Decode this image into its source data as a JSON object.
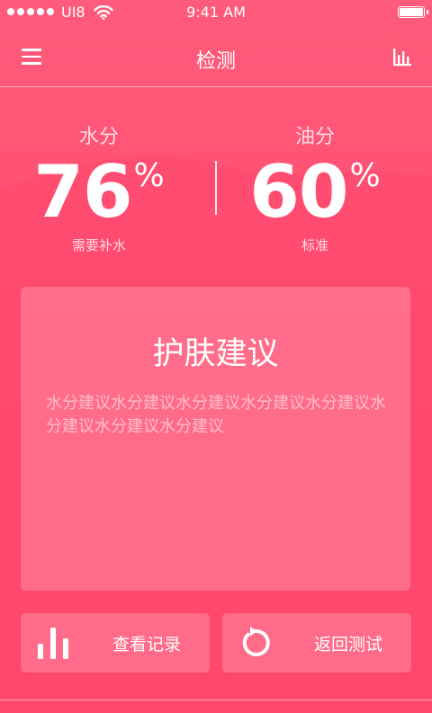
{
  "status_bar": {
    "carrier": "UI8",
    "time": "9:41 AM"
  },
  "nav": {
    "title": "检测"
  },
  "metrics": {
    "water": {
      "label": "水分",
      "value": "76",
      "unit": "%",
      "status": "需要补水"
    },
    "oil": {
      "label": "油分",
      "value": "60",
      "unit": "%",
      "status": "标准"
    }
  },
  "advice": {
    "title": "护肤建议",
    "text": "水分建议水分建议水分建议水分建议水分建议水分建议水分建议水分建议"
  },
  "actions": {
    "records_label": "查看记录",
    "retest_label": "返回测试"
  },
  "icons": {
    "menu": "menu-icon",
    "stats": "bar-chart-icon",
    "records": "bar-chart-icon",
    "retest": "refresh-icon",
    "wifi": "wifi-icon",
    "battery": "battery-icon"
  },
  "colors": {
    "background_top": "#ff5b7c",
    "background_bottom": "#ff4767",
    "text": "#ffffff"
  }
}
